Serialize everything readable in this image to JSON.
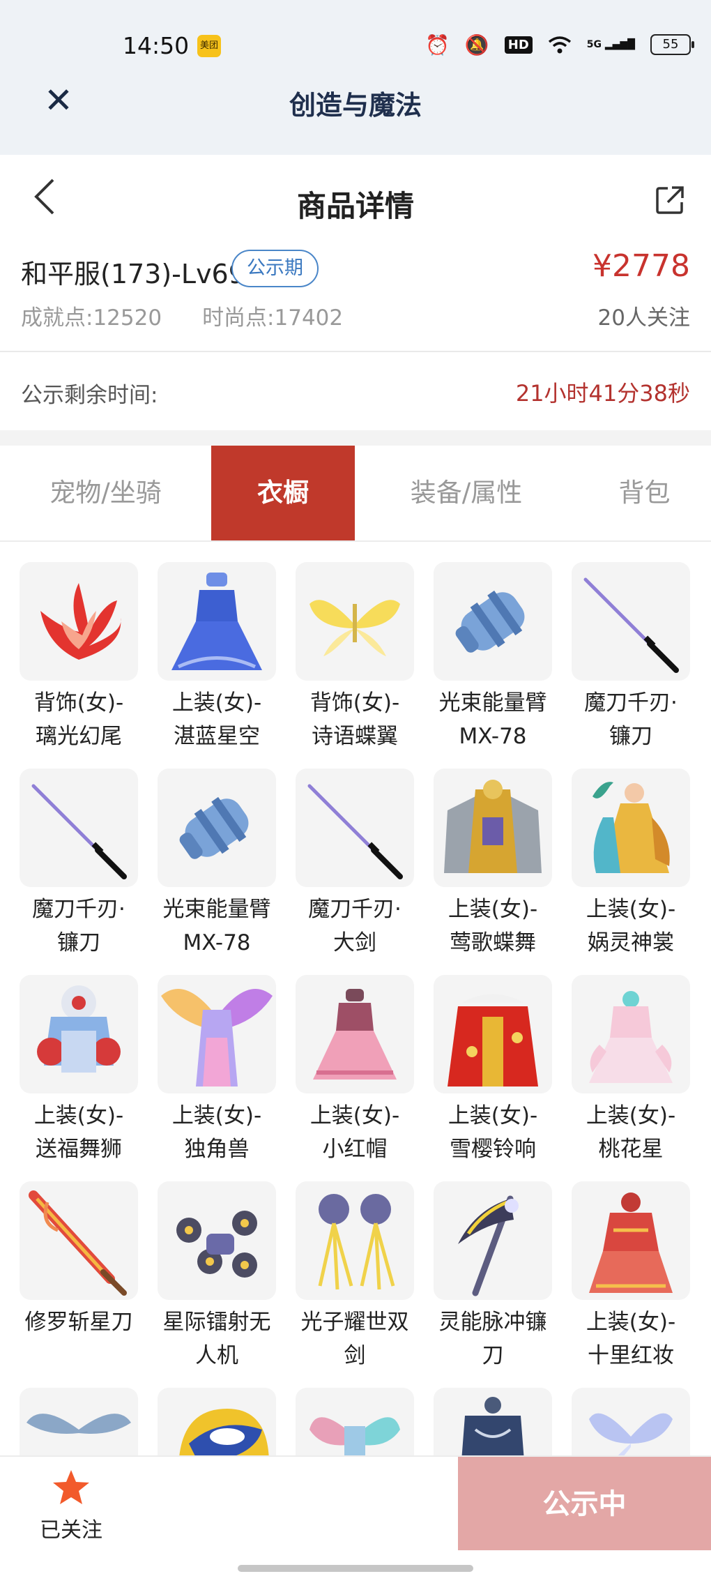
{
  "status": {
    "time": "14:50",
    "meituan": "美团",
    "hd": "HD",
    "net": "5G",
    "battery": "55"
  },
  "app": {
    "title": "创造与魔法"
  },
  "nav": {
    "title": "商品详情"
  },
  "account": {
    "name": "和平服(173)-Lv69",
    "badge": "公示期",
    "price": "¥2778",
    "achievement": "成就点:12520",
    "fashion": "时尚点:17402",
    "followers": "20人关注"
  },
  "countdown": {
    "label": "公示剩余时间:",
    "value": "21小时41分38秒"
  },
  "tabs": [
    {
      "label": "宠物/坐骑",
      "active": false
    },
    {
      "label": "衣橱",
      "active": true
    },
    {
      "label": "装备/属性",
      "active": false
    },
    {
      "label": "背包",
      "active": false
    }
  ],
  "items": [
    {
      "name": "背饰(女)-\n璃光幻尾",
      "icon": "red-tail-icon"
    },
    {
      "name": "上装(女)-\n湛蓝星空",
      "icon": "blue-dress-icon"
    },
    {
      "name": "背饰(女)-\n诗语蝶翼",
      "icon": "butterfly-wings-icon"
    },
    {
      "name": "光束能量臂\nMX-78",
      "icon": "energy-arm-icon"
    },
    {
      "name": "魔刀千刃·\n镰刀",
      "icon": "katana-icon"
    },
    {
      "name": "魔刀千刃·\n镰刀",
      "icon": "katana-icon"
    },
    {
      "name": "光束能量臂\nMX-78",
      "icon": "energy-arm-icon"
    },
    {
      "name": "魔刀千刃·\n大剑",
      "icon": "katana-icon"
    },
    {
      "name": "上装(女)-\n莺歌蝶舞",
      "icon": "golden-armor-icon"
    },
    {
      "name": "上装(女)-\n娲灵神裳",
      "icon": "goddess-robe-icon"
    },
    {
      "name": "上装(女)-\n送福舞狮",
      "icon": "lion-costume-icon"
    },
    {
      "name": "上装(女)-\n独角兽",
      "icon": "unicorn-dress-icon"
    },
    {
      "name": "上装(女)-\n小红帽",
      "icon": "pink-dress-icon"
    },
    {
      "name": "上装(女)-\n雪樱铃响",
      "icon": "red-kimono-icon"
    },
    {
      "name": "上装(女)-\n桃花星",
      "icon": "peach-dress-icon"
    },
    {
      "name": "修罗斩星刀",
      "icon": "flame-sword-icon"
    },
    {
      "name": "星际镭射无\n人机",
      "icon": "drone-icon"
    },
    {
      "name": "光子耀世双\n剑",
      "icon": "twin-blades-icon"
    },
    {
      "name": "灵能脉冲镰\n刀",
      "icon": "scythe-icon"
    },
    {
      "name": "上装(女)-\n十里红妆",
      "icon": "bridal-gown-icon"
    },
    {
      "name": "",
      "icon": "feather-wings-icon"
    },
    {
      "name": "",
      "icon": "cap-icon"
    },
    {
      "name": "",
      "icon": "fairy-wings-icon"
    },
    {
      "name": "",
      "icon": "dark-gown-icon"
    },
    {
      "name": "",
      "icon": "crystal-wings-icon"
    }
  ],
  "bottom": {
    "fav_label": "已关注",
    "cta_label": "公示中"
  },
  "colors": {
    "accent": "#c0392b",
    "price": "#c8332e",
    "badge": "#3a78c0",
    "cta": "#e3a7a6",
    "star": "#f25a2b"
  }
}
